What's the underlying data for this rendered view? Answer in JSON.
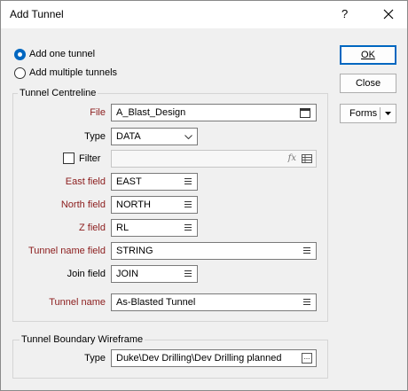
{
  "window": {
    "title": "Add Tunnel",
    "help_label": "?"
  },
  "mode": {
    "add_one": "Add one tunnel",
    "add_multiple": "Add multiple tunnels"
  },
  "centreline": {
    "group_label": "Tunnel Centreline",
    "file_label": "File",
    "file_value": "A_Blast_Design",
    "type_label": "Type",
    "type_value": "DATA",
    "filter_label": "Filter",
    "filter_value": "",
    "east_label": "East field",
    "east_value": "EAST",
    "north_label": "North field",
    "north_value": "NORTH",
    "z_label": "Z field",
    "z_value": "RL",
    "name_field_label": "Tunnel name field",
    "name_field_value": "STRING",
    "join_label": "Join field",
    "join_value": "JOIN",
    "tunnel_name_label": "Tunnel name",
    "tunnel_name_value": "As-Blasted Tunnel"
  },
  "boundary": {
    "group_label": "Tunnel Boundary Wireframe",
    "type_label": "Type",
    "type_value": "Duke\\Dev Drilling\\Dev Drilling planned"
  },
  "buttons": {
    "ok": "OK",
    "close": "Close",
    "forms": "Forms"
  }
}
